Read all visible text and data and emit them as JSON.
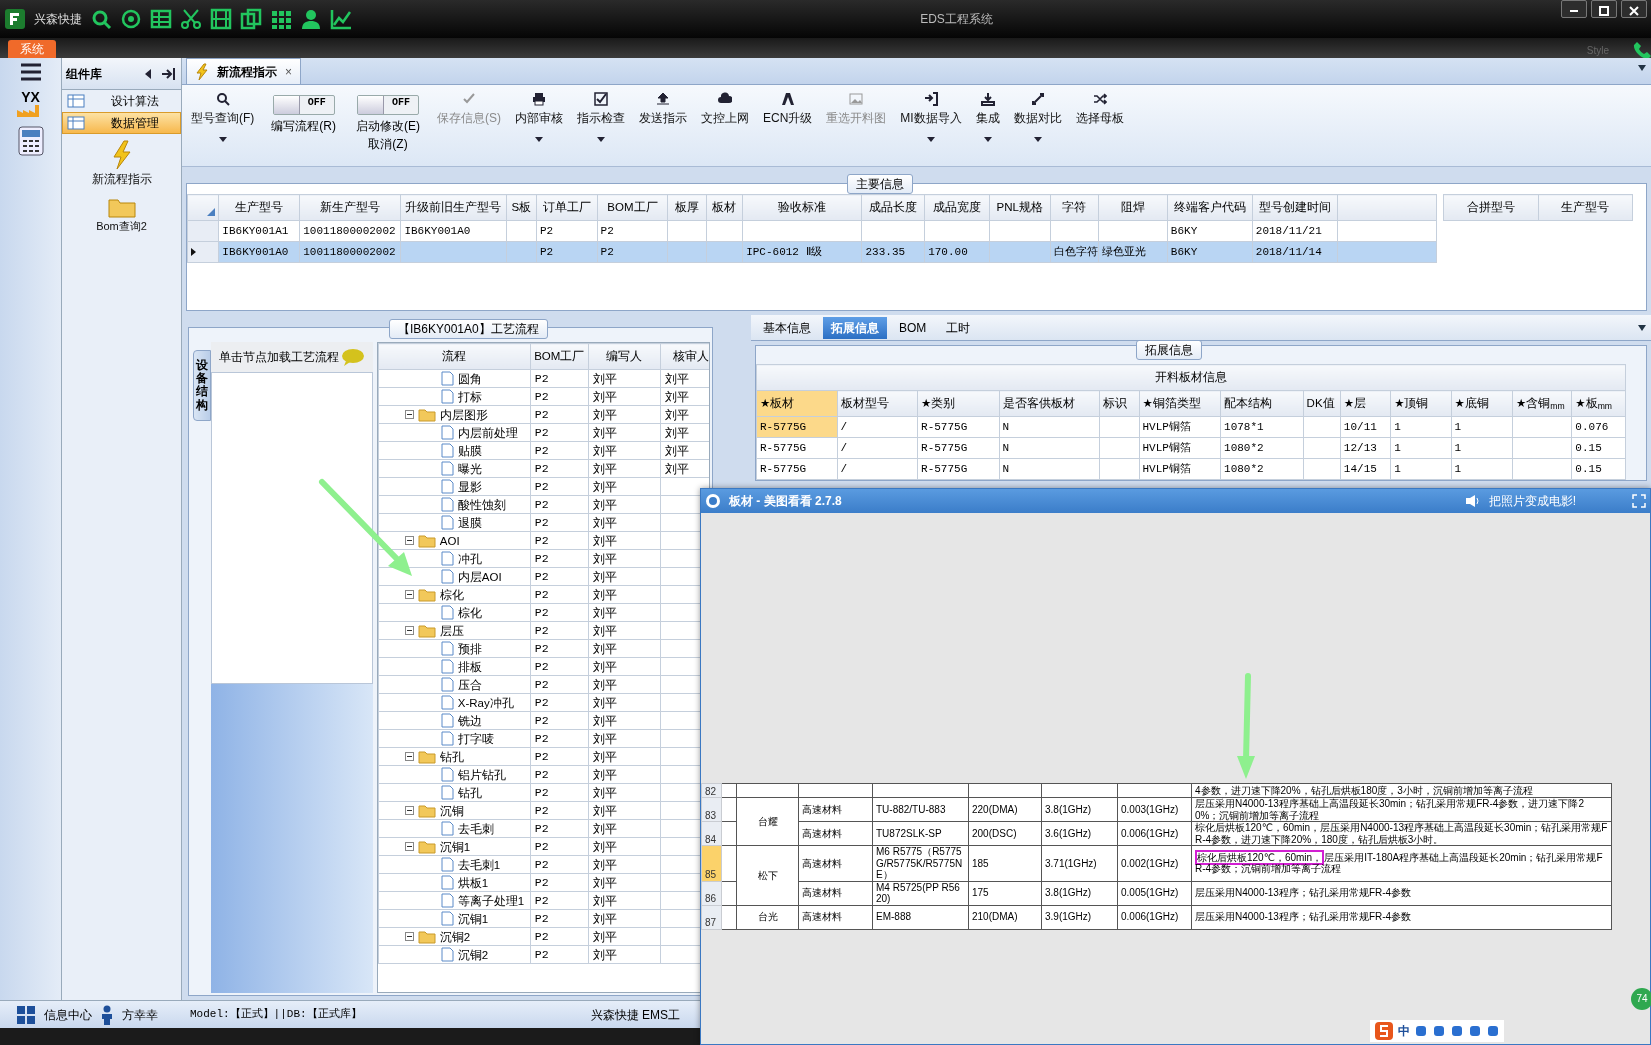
{
  "app": {
    "brand": "兴森快捷",
    "title": "EDS工程系统",
    "style_label": "Style",
    "menu_tab": "系统",
    "logo_text": "YX"
  },
  "component_library": {
    "title": "组件库",
    "items": [
      {
        "label": "设计算法",
        "selected": false
      },
      {
        "label": "数据管理",
        "selected": true
      }
    ],
    "shortcuts": [
      {
        "label": "新流程指示"
      },
      {
        "label": "Bom查询2"
      }
    ]
  },
  "document_tab": {
    "title": "新流程指示",
    "close": "×"
  },
  "toolbar": [
    {
      "kind": "button",
      "label": "型号查询(F)",
      "dropdown": true,
      "disabled": false
    },
    {
      "kind": "toggle",
      "label": "编写流程(R)",
      "switch_text": "OFF",
      "on": false
    },
    {
      "kind": "toggle",
      "label": "启动修改(E)",
      "sub_label": "取消(Z)",
      "switch_text": "OFF",
      "on": false
    },
    {
      "kind": "button",
      "label": "保存信息(S)",
      "dropdown": false,
      "disabled": true
    },
    {
      "kind": "button",
      "label": "内部审核",
      "dropdown": true,
      "disabled": false
    },
    {
      "kind": "button",
      "label": "指示检查",
      "dropdown": true,
      "disabled": false
    },
    {
      "kind": "button",
      "label": "发送指示",
      "dropdown": false,
      "disabled": false
    },
    {
      "kind": "button",
      "label": "文控上网",
      "dropdown": false,
      "disabled": false
    },
    {
      "kind": "button",
      "label": "ECN升级",
      "dropdown": false,
      "disabled": false
    },
    {
      "kind": "button",
      "label": "重选开料图",
      "dropdown": false,
      "disabled": true
    },
    {
      "kind": "button",
      "label": "MI数据导入",
      "dropdown": true,
      "disabled": false
    },
    {
      "kind": "button",
      "label": "集成",
      "dropdown": true,
      "disabled": false
    },
    {
      "kind": "button",
      "label": "数据对比",
      "dropdown": true,
      "disabled": false
    },
    {
      "kind": "button",
      "label": "选择母板",
      "dropdown": false,
      "disabled": false
    }
  ],
  "main_info": {
    "title": "主要信息",
    "columns": [
      "生产型号",
      "新生产型号",
      "升级前旧生产型号",
      "S板",
      "订单工厂",
      "BOM工厂",
      "板厚",
      "板材",
      "验收标准",
      "成品长度",
      "成品宽度",
      "PNL规格",
      "字符",
      "阻焊",
      "终端客户代码",
      "型号创建时间"
    ],
    "rows": [
      {
        "selected": false,
        "cells": [
          "IB6KY001A1",
          "10011800002002",
          "IB6KY001A0",
          null,
          "P2",
          "P2",
          null,
          null,
          null,
          null,
          null,
          null,
          null,
          null,
          "B6KY",
          "2018/11/21"
        ]
      },
      {
        "selected": true,
        "cells": [
          "IB6KY001A0",
          "10011800002002",
          null,
          null,
          "P2",
          "P2",
          null,
          null,
          "IPC-6012 Ⅱ级",
          "233.35",
          "170.00",
          null,
          "白色字符",
          "绿色亚光",
          "B6KY",
          "2018/11/14"
        ]
      }
    ],
    "side_columns": [
      "合拼型号",
      "生产型号"
    ]
  },
  "process_flow": {
    "title": "【IB6KY001A0】工艺流程",
    "side_tab": "设备结构",
    "panel_header": "单击节点加载工艺流程",
    "columns": [
      "流程",
      "BOM工厂",
      "编写人",
      "核审人"
    ],
    "nodes": [
      {
        "kind": "file",
        "name": "圆角",
        "bom_factory": "P2",
        "writer": "刘平",
        "reviewer": "刘平"
      },
      {
        "kind": "file",
        "name": "打标",
        "bom_factory": "P2",
        "writer": "刘平",
        "reviewer": "刘平"
      },
      {
        "kind": "folder",
        "name": "内层图形",
        "bom_factory": "P2",
        "writer": "刘平",
        "reviewer": "刘平",
        "expanded": true,
        "children": [
          {
            "kind": "file",
            "name": "内层前处理",
            "bom_factory": "P2",
            "writer": "刘平",
            "reviewer": "刘平"
          },
          {
            "kind": "file",
            "name": "贴膜",
            "bom_factory": "P2",
            "writer": "刘平",
            "reviewer": "刘平"
          },
          {
            "kind": "file",
            "name": "曝光",
            "bom_factory": "P2",
            "writer": "刘平",
            "reviewer": "刘平"
          },
          {
            "kind": "file",
            "name": "显影",
            "bom_factory": "P2",
            "writer": "刘平"
          },
          {
            "kind": "file",
            "name": "酸性蚀刻",
            "bom_factory": "P2",
            "writer": "刘平"
          },
          {
            "kind": "file",
            "name": "退膜",
            "bom_factory": "P2",
            "writer": "刘平"
          }
        ]
      },
      {
        "kind": "folder",
        "name": "AOI",
        "bom_factory": "P2",
        "writer": "刘平",
        "expanded": true,
        "children": [
          {
            "kind": "file",
            "name": "冲孔",
            "bom_factory": "P2",
            "writer": "刘平"
          },
          {
            "kind": "file",
            "name": "内层AOI",
            "bom_factory": "P2",
            "writer": "刘平"
          }
        ]
      },
      {
        "kind": "folder",
        "name": "棕化",
        "bom_factory": "P2",
        "writer": "刘平",
        "expanded": true,
        "children": [
          {
            "kind": "file",
            "name": "棕化",
            "bom_factory": "P2",
            "writer": "刘平"
          }
        ]
      },
      {
        "kind": "folder",
        "name": "层压",
        "bom_factory": "P2",
        "writer": "刘平",
        "expanded": true,
        "children": [
          {
            "kind": "file",
            "name": "预排",
            "bom_factory": "P2",
            "writer": "刘平"
          },
          {
            "kind": "file",
            "name": "排板",
            "bom_factory": "P2",
            "writer": "刘平"
          },
          {
            "kind": "file",
            "name": "压合",
            "bom_factory": "P2",
            "writer": "刘平"
          },
          {
            "kind": "file",
            "name": "X-Ray冲孔",
            "bom_factory": "P2",
            "writer": "刘平"
          },
          {
            "kind": "file",
            "name": "铣边",
            "bom_factory": "P2",
            "writer": "刘平"
          },
          {
            "kind": "file",
            "name": "打字唛",
            "bom_factory": "P2",
            "writer": "刘平"
          }
        ]
      },
      {
        "kind": "folder",
        "name": "钻孔",
        "bom_factory": "P2",
        "writer": "刘平",
        "expanded": true,
        "children": [
          {
            "kind": "file",
            "name": "铝片钻孔",
            "bom_factory": "P2",
            "writer": "刘平"
          },
          {
            "kind": "file",
            "name": "钻孔",
            "bom_factory": "P2",
            "writer": "刘平"
          }
        ]
      },
      {
        "kind": "folder",
        "name": "沉铜",
        "bom_factory": "P2",
        "writer": "刘平",
        "expanded": true,
        "children": [
          {
            "kind": "file",
            "name": "去毛刺",
            "bom_factory": "P2",
            "writer": "刘平"
          }
        ]
      },
      {
        "kind": "folder",
        "name": "沉铜1",
        "bom_factory": "P2",
        "writer": "刘平",
        "expanded": true,
        "children": [
          {
            "kind": "file",
            "name": "去毛刺1",
            "bom_factory": "P2",
            "writer": "刘平"
          },
          {
            "kind": "file",
            "name": "烘板1",
            "bom_factory": "P2",
            "writer": "刘平"
          },
          {
            "kind": "file",
            "name": "等离子处理1",
            "bom_factory": "P2",
            "writer": "刘平"
          },
          {
            "kind": "file",
            "name": "沉铜1",
            "bom_factory": "P2",
            "writer": "刘平"
          }
        ]
      },
      {
        "kind": "folder",
        "name": "沉铜2",
        "bom_factory": "P2",
        "writer": "刘平",
        "expanded": true,
        "children": [
          {
            "kind": "file",
            "name": "沉铜2",
            "bom_factory": "P2",
            "writer": "刘平"
          }
        ]
      }
    ]
  },
  "detail_tabs": [
    {
      "label": "基本信息",
      "selected": false
    },
    {
      "label": "拓展信息",
      "selected": true
    },
    {
      "label": "BOM",
      "selected": false
    },
    {
      "label": "工时",
      "selected": false
    }
  ],
  "extended_info": {
    "title": "拓展信息",
    "table_title": "开料板材信息",
    "columns": [
      "★板材",
      "板材型号",
      "★类别",
      "是否客供板材",
      "标识",
      "★铜箔类型",
      "配本结构",
      "DK值",
      "★层",
      "★顶铜",
      "★底铜",
      "★含铜$_{mm}$",
      "★板$_{mm}$"
    ],
    "rows": [
      {
        "selected": true,
        "cells": [
          "R-5775G",
          "/",
          "R-5775G",
          "N",
          null,
          "HVLP铜箔",
          "1078*1",
          null,
          "10/11",
          "1",
          "1",
          null,
          "0.076"
        ]
      },
      {
        "selected": false,
        "cells": [
          "R-5775G",
          "/",
          "R-5775G",
          "N",
          null,
          "HVLP铜箔",
          "1080*2",
          null,
          "12/13",
          "1",
          "1",
          null,
          "0.15"
        ]
      },
      {
        "selected": false,
        "cells": [
          "R-5775G",
          "/",
          "R-5775G",
          "N",
          null,
          "HVLP铜箔",
          "1080*2",
          null,
          "14/15",
          "1",
          "1",
          null,
          "0.15"
        ]
      }
    ]
  },
  "status_bar": {
    "info_center": "信息中心",
    "user": "方幸幸",
    "environment": "Model:【正式】||DB:【正式库】",
    "company": "兴森快捷 EMS工"
  },
  "tray": {
    "ime": "中",
    "badge": "74"
  },
  "viewer": {
    "title": "板材 - 美图看看 2.7.8",
    "promo": "把照片变成电影!",
    "sheet_groups": [
      {
        "rows": [
          {
            "row_number": "82",
            "selected": false,
            "note": "4参数，进刀速下降20%，钻孔后烘板180度，3小时，沉铜前增加等离子流程"
          }
        ]
      },
      {
        "brand": "台耀",
        "rows": [
          {
            "row_number": "83",
            "selected": false,
            "material": "高速材料",
            "model": "TU-882/TU-883",
            "tg": "220(DMA)",
            "dk": "3.8(1GHz)",
            "df": "0.003(1GHz)",
            "note": "层压采用N4000-13程序基础上高温段延长30min；钻孔采用常规FR-4参数，进刀速下降20%；沉铜前增加等离子流程"
          },
          {
            "row_number": "84",
            "selected": false,
            "material": "高速材料",
            "model": "TU872SLK-SP",
            "tg": "200(DSC)",
            "dk": "3.6(1GHz)",
            "df": "0.006(1GHz)",
            "note": "棕化后烘板120℃，60min，层压采用N4000-13程序基础上高温段延长30min；钻孔采用常规FR-4参数，进刀速下降20%，180度，钻孔后烘板3小时。"
          }
        ]
      },
      {
        "brand": "松下",
        "rows": [
          {
            "row_number": "85",
            "selected": true,
            "material": "高速材料",
            "model": "M6 R5775（R5775G/R5775K/R5775NE）",
            "tg": "185",
            "dk": "3.71(1GHz)",
            "df": "0.002(1GHz)",
            "highlight": "棕化后烘板120℃，60min，",
            "note": "层压采用IT-180A程序基础上高温段延长20min；钻孔采用常规FR-4参数；沉铜前增加等离子流程"
          },
          {
            "row_number": "86",
            "selected": false,
            "material": "高速材料",
            "model": "M4 R5725(PP R5620)",
            "tg": "175",
            "dk": "3.8(1GHz)",
            "df": "0.005(1GHz)",
            "note": "层压采用N4000-13程序；钻孔采用常规FR-4参数"
          }
        ]
      },
      {
        "brand": "台光",
        "rows": [
          {
            "row_number": "87",
            "selected": false,
            "material": "高速材料",
            "model": "EM-888",
            "tg": "210(DMA)",
            "dk": "3.9(1GHz)",
            "df": "0.006(1GHz)",
            "note": "层压采用N4000-13程序；钻孔采用常规FR-4参数"
          }
        ]
      }
    ]
  }
}
